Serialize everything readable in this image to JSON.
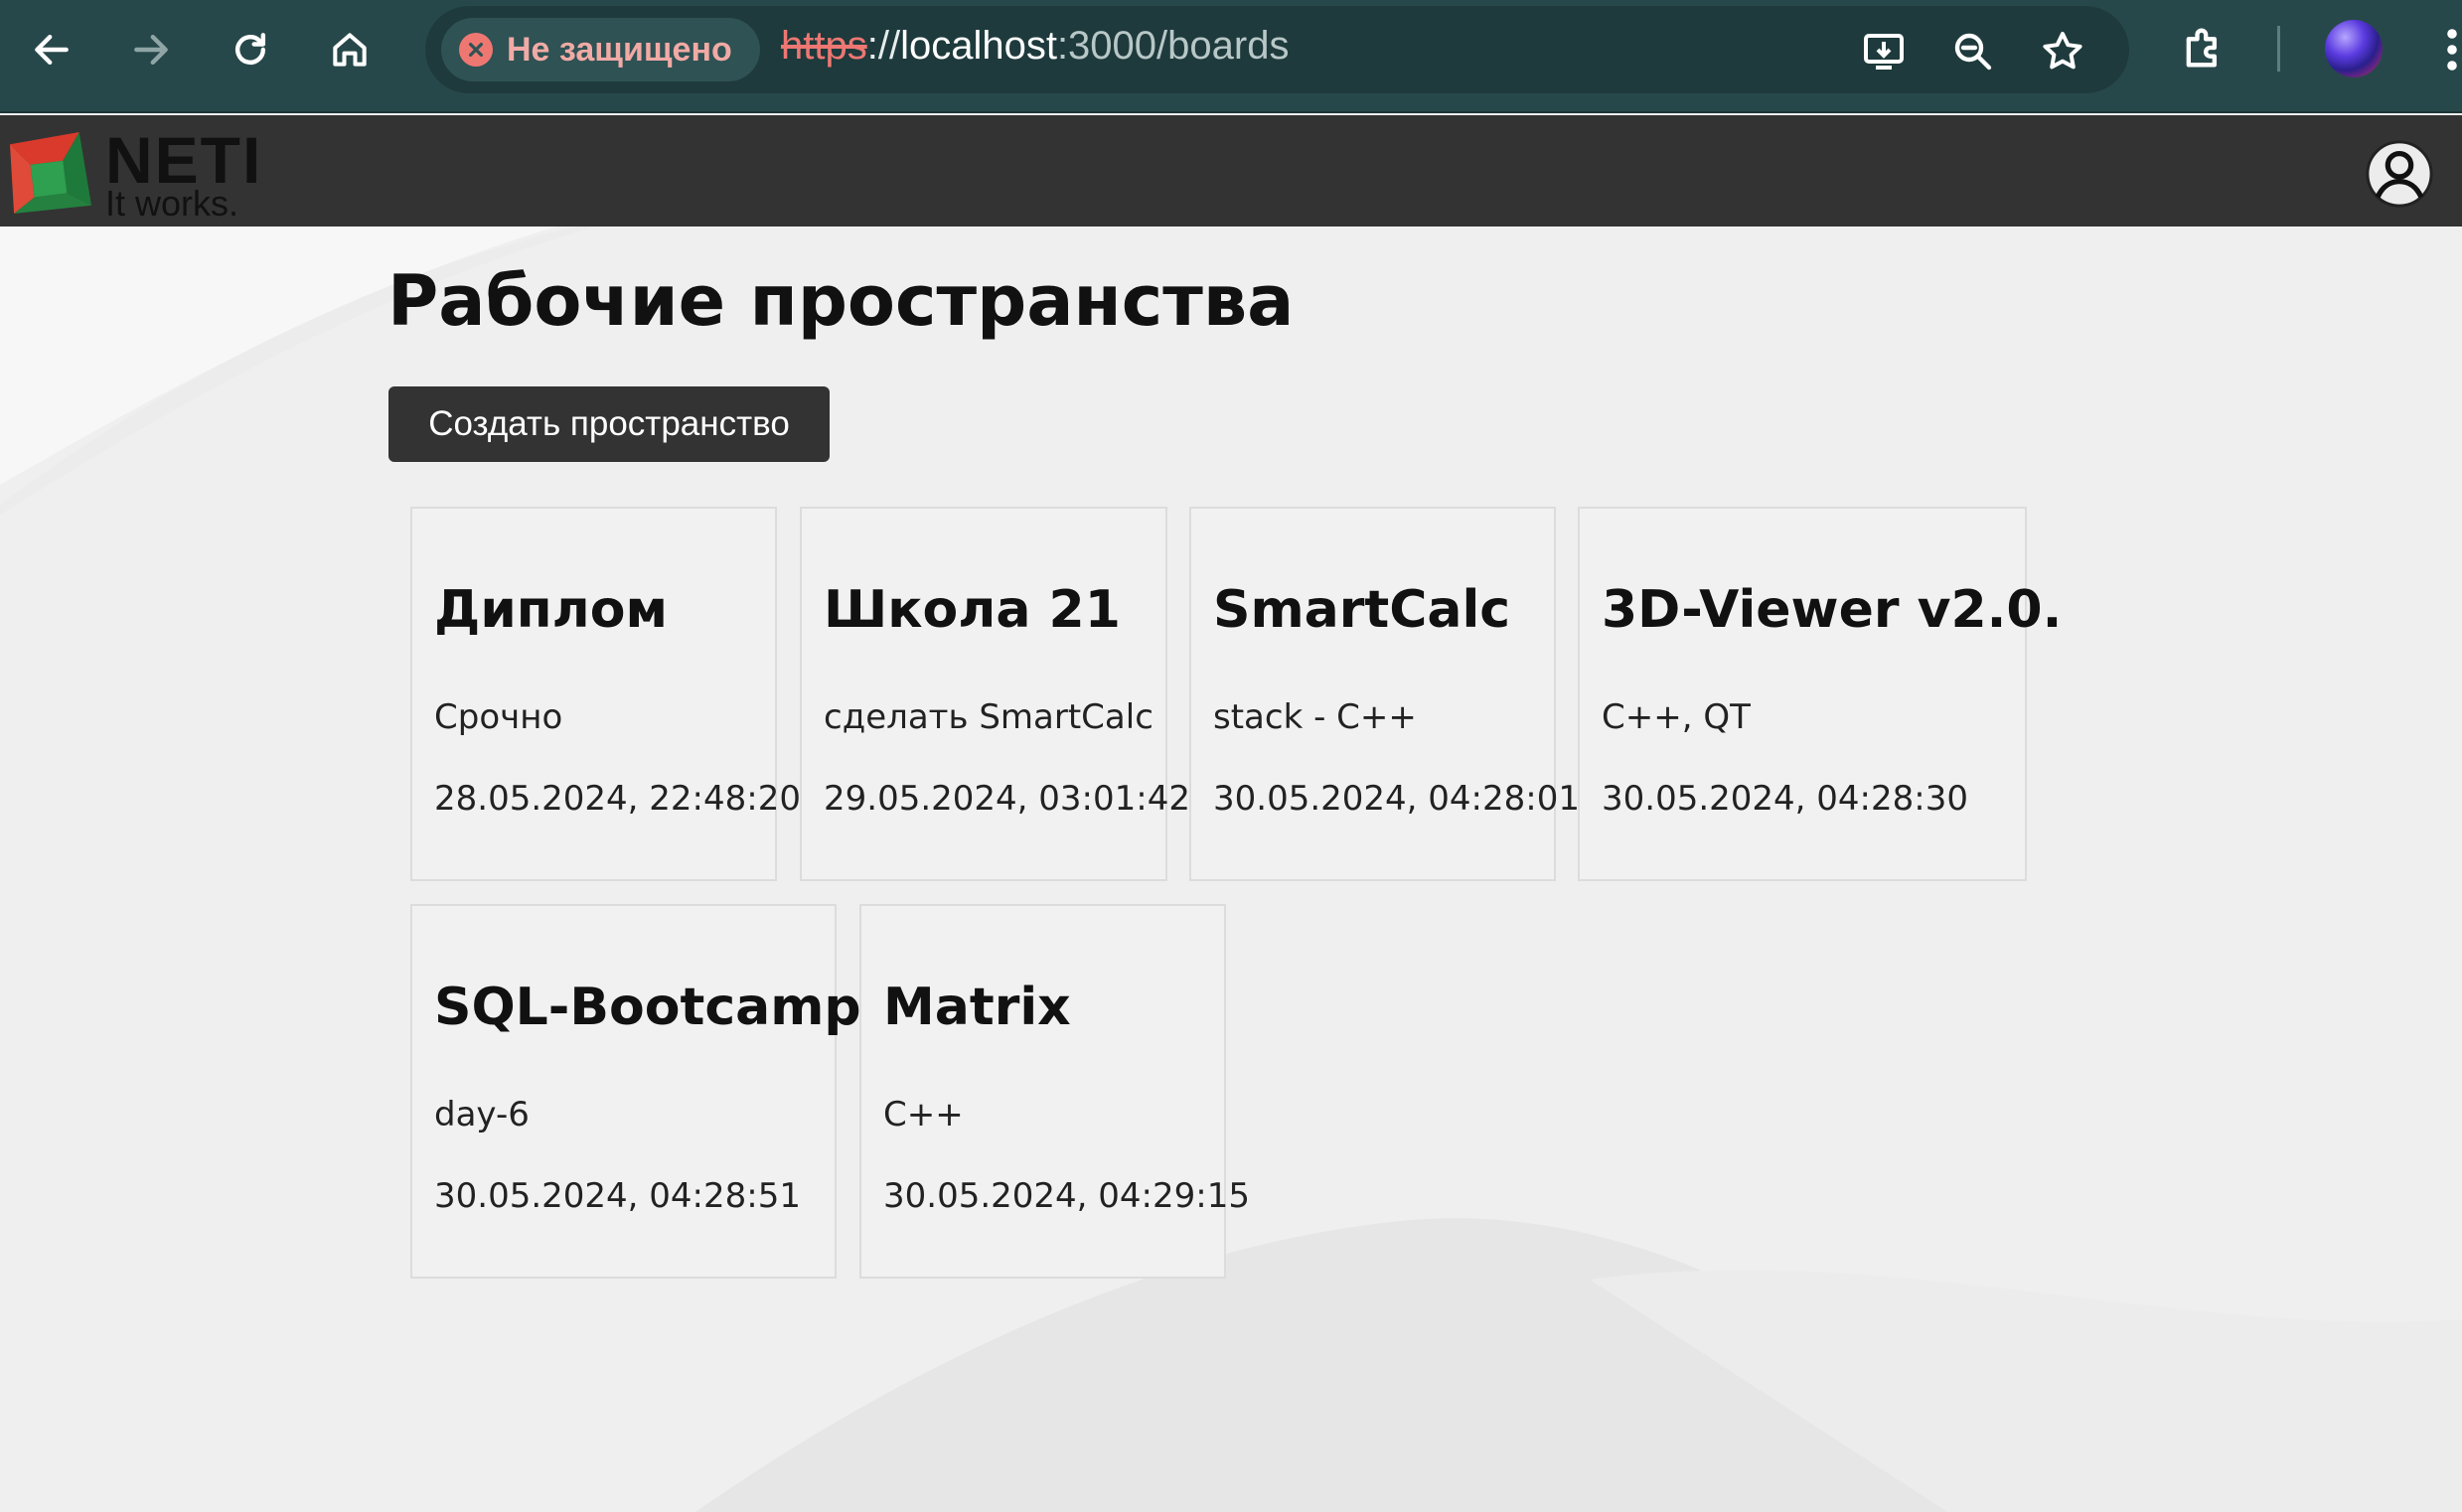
{
  "browser": {
    "security_label": "Не защищено",
    "url_scheme": "https",
    "url_sep": "://",
    "url_host": "localhost",
    "url_path": ":3000/boards",
    "icons": [
      "back-icon",
      "forward-icon",
      "reload-icon",
      "home-icon",
      "install-app-icon",
      "zoom-icon",
      "bookmark-star-icon",
      "extensions-icon",
      "profile-icon",
      "menu-icon"
    ]
  },
  "header": {
    "logo_name": "NETI",
    "logo_tagline": "It works."
  },
  "main": {
    "title": "Рабочие пространства",
    "create_button": "Создать пространство"
  },
  "boards": [
    {
      "title": "Диплом",
      "description": "Срочно",
      "date": "28.05.2024, 22:48:20"
    },
    {
      "title": "Школа 21",
      "description": "сделать SmartCalc",
      "date": "29.05.2024, 03:01:42"
    },
    {
      "title": "SmartCalc",
      "description": "stack - C++",
      "date": "30.05.2024, 04:28:01"
    },
    {
      "title": "3D-Viewer v2.0.",
      "description": "C++, QT",
      "date": "30.05.2024, 04:28:30"
    },
    {
      "title": "SQL-Bootcamp",
      "description": "day-6",
      "date": "30.05.2024, 04:28:51"
    },
    {
      "title": "Matrix",
      "description": "C++",
      "date": "30.05.2024, 04:29:15"
    }
  ],
  "colors": {
    "browser_bar": "#27484a",
    "app_header": "#333333",
    "page_bg": "#efefef",
    "insecure_red": "#ee7772"
  }
}
